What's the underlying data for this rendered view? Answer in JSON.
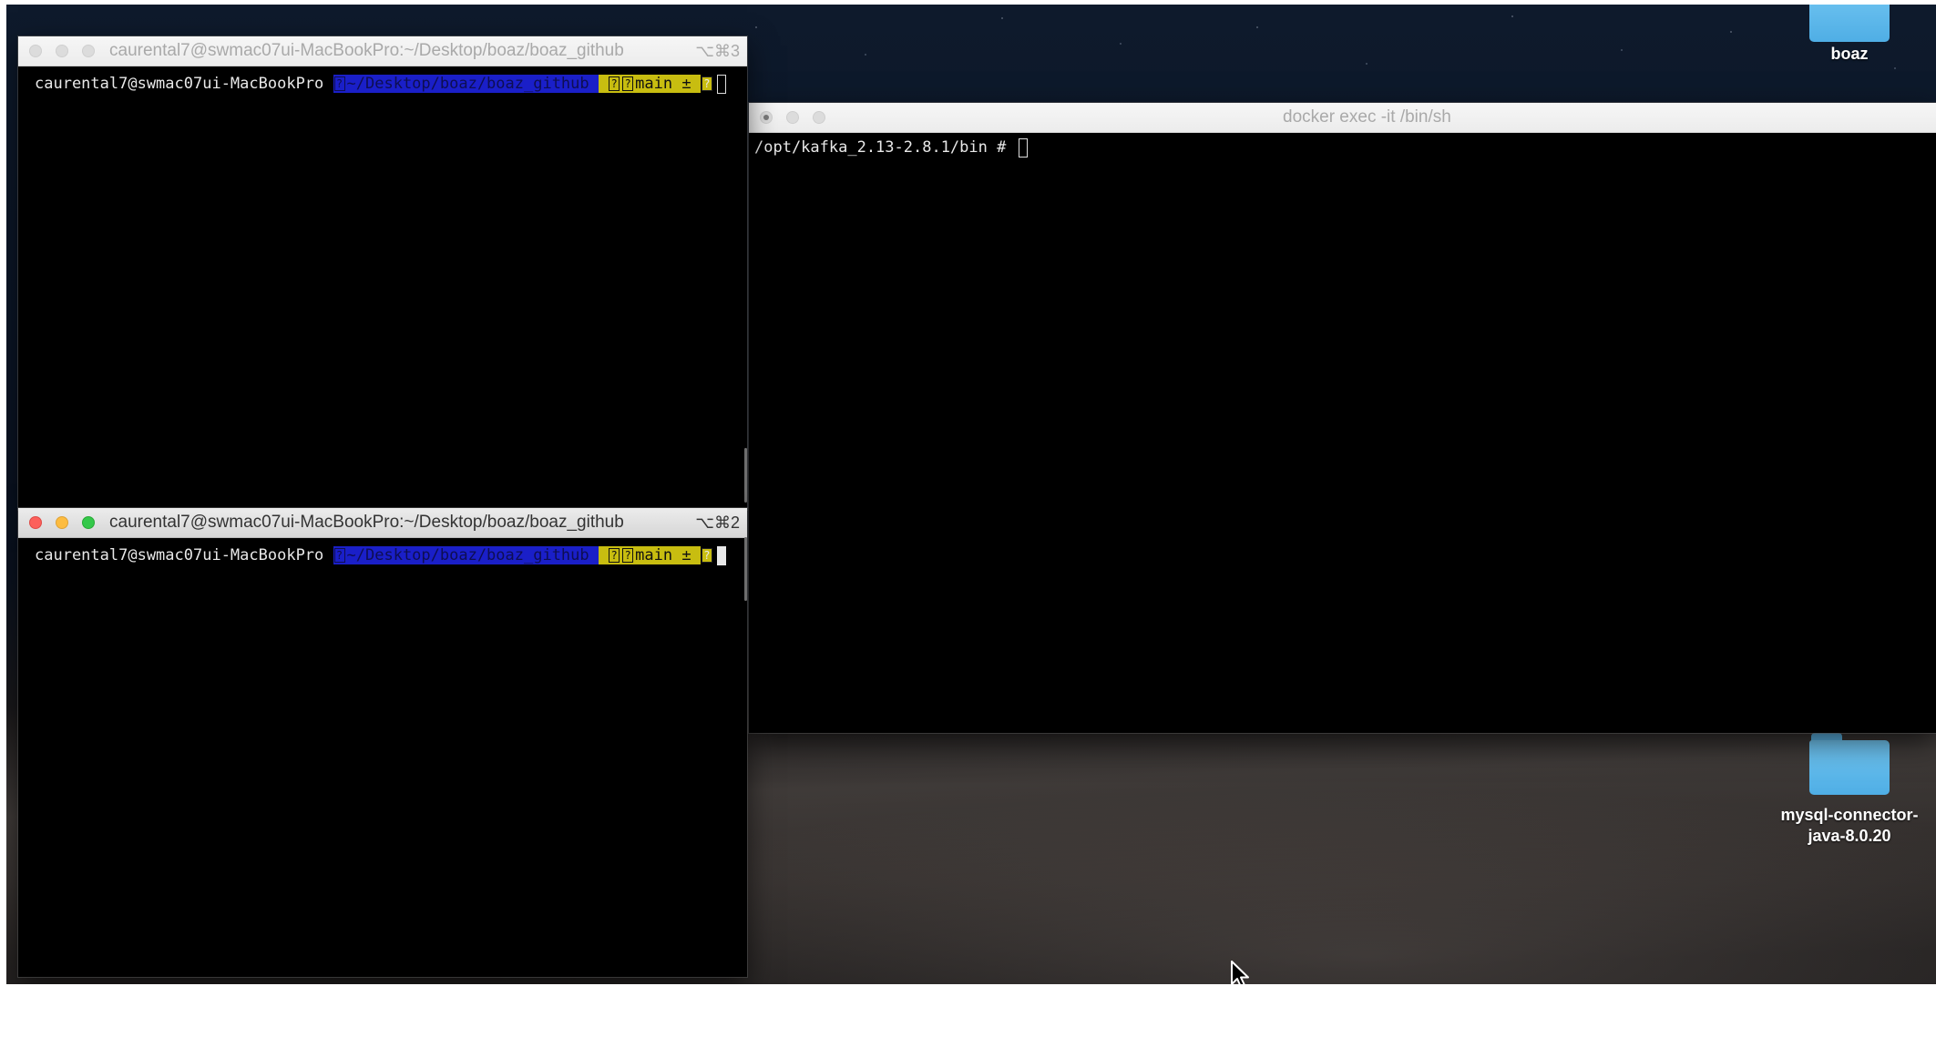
{
  "desktop": {
    "icons": [
      {
        "label": "boaz",
        "icon": "folder-icon"
      },
      {
        "label_line1": "mysql-connector-",
        "label_line2": "java-8.0.20",
        "icon": "folder-icon"
      }
    ]
  },
  "terminal_top": {
    "title": "caurental7@swmac07ui-MacBookPro:~/Desktop/boaz/boaz_github",
    "shortcut": "⌥⌘3",
    "prompt": {
      "user_host": "caurental7@swmac07ui-MacBookPro",
      "path": "~/Desktop/boaz/boaz_github",
      "branch": "main ±",
      "glyph": "?"
    }
  },
  "terminal_bottom": {
    "title": "caurental7@swmac07ui-MacBookPro:~/Desktop/boaz/boaz_github",
    "shortcut": "⌥⌘2",
    "prompt": {
      "user_host": "caurental7@swmac07ui-MacBookPro",
      "path": "~/Desktop/boaz/boaz_github",
      "branch": "main ±",
      "glyph": "?"
    }
  },
  "terminal_docker": {
    "title": "docker exec -it /bin/sh",
    "prompt": "/opt/kafka_2.13-2.8.1/bin #"
  },
  "colors": {
    "prompt_blue": "#1a1fc8",
    "prompt_yellow": "#c8bd10",
    "folder_blue": "#5cb4e6"
  }
}
